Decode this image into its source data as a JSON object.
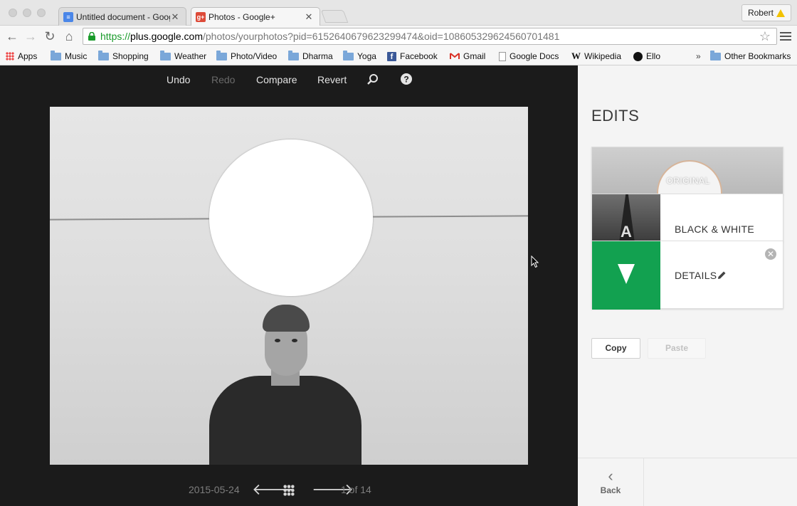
{
  "browser": {
    "tabs": [
      {
        "title": "Untitled document - Goog",
        "favicon": "docs-icon",
        "favicon_color": "#4a86e8"
      },
      {
        "title": "Photos - Google+",
        "favicon": "gplus-icon",
        "favicon_color": "#dd4b39"
      }
    ],
    "profile_name": "Robert",
    "url": {
      "scheme": "https://",
      "host": "plus.google.com",
      "path": "/photos/yourphotos?pid=6152640679623299474&oid=108605329624560701481"
    },
    "bookmarks": [
      {
        "label": "Apps",
        "icon": "apps-icon"
      },
      {
        "label": "Music",
        "icon": "folder-icon"
      },
      {
        "label": "Shopping",
        "icon": "folder-icon"
      },
      {
        "label": "Weather",
        "icon": "folder-icon"
      },
      {
        "label": "Photo/Video",
        "icon": "folder-icon"
      },
      {
        "label": "Dharma",
        "icon": "folder-icon"
      },
      {
        "label": "Yoga",
        "icon": "folder-icon"
      },
      {
        "label": "Facebook",
        "icon": "facebook-icon"
      },
      {
        "label": "Gmail",
        "icon": "gmail-icon"
      },
      {
        "label": "Google Docs",
        "icon": "document-icon"
      },
      {
        "label": "Wikipedia",
        "icon": "wikipedia-icon"
      },
      {
        "label": "Ello",
        "icon": "ello-icon"
      }
    ],
    "overflow_label": "»",
    "other_bookmarks": "Other Bookmarks"
  },
  "editor": {
    "toolbar": {
      "undo": "Undo",
      "redo": "Redo",
      "compare": "Compare",
      "revert": "Revert"
    },
    "footer": {
      "date": "2015-05-24",
      "position": "1 of 14"
    }
  },
  "edits_panel": {
    "title": "EDITS",
    "cards": {
      "original": "ORIGINAL",
      "black_white": "BLACK & WHITE",
      "details": "DETAILS"
    },
    "copy_label": "Copy",
    "paste_label": "Paste",
    "back_label": "Back",
    "colors": {
      "details_accent": "#12a150"
    }
  }
}
